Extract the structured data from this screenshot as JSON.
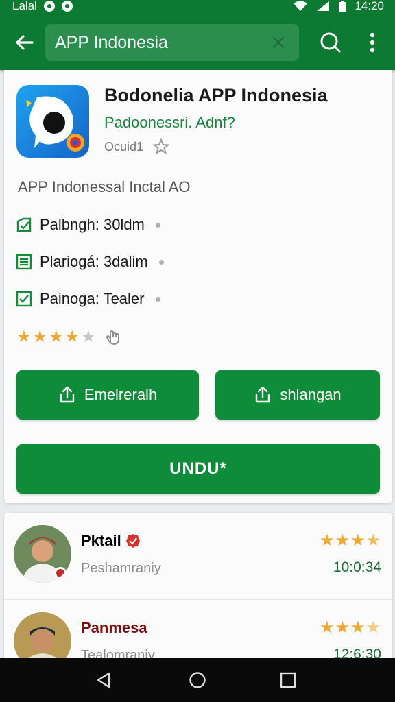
{
  "status_bar": {
    "carrier": "Lalal",
    "time": "14:20"
  },
  "search": {
    "value": "APP Indonesia",
    "placeholder": ""
  },
  "app": {
    "title": "Bodonelia APP Indonesia",
    "developer": "Padoonessri. Adnf?",
    "size": "Ocuid1",
    "description": "APP Indonessal Inctal AO",
    "info": [
      {
        "label": "Palbngh: 30ldm",
        "icon": "edit-check-icon"
      },
      {
        "label": "Plariogá: 3dalim",
        "icon": "list-icon"
      },
      {
        "label": "Painoga: Tealer",
        "icon": "checkbox-icon"
      }
    ],
    "rating": 4.5
  },
  "buttons": {
    "share_a": "Emelreralh",
    "share_b": "shlangan",
    "download": "UNDU*"
  },
  "reviews": [
    {
      "name": "Pktail",
      "subtitle": "Peshamraniy",
      "stars": 3.5,
      "time": "10:0:34",
      "verified": true,
      "name_color": "#1a1a1a"
    },
    {
      "name": "Panmesa",
      "subtitle": "Tealomraniy",
      "stars": 3.5,
      "time": "12:6:30",
      "verified": false,
      "name_color": "#7a1010"
    }
  ],
  "colors": {
    "primary": "#0d7a34",
    "button": "#0f8c39",
    "star": "#f0a830"
  }
}
